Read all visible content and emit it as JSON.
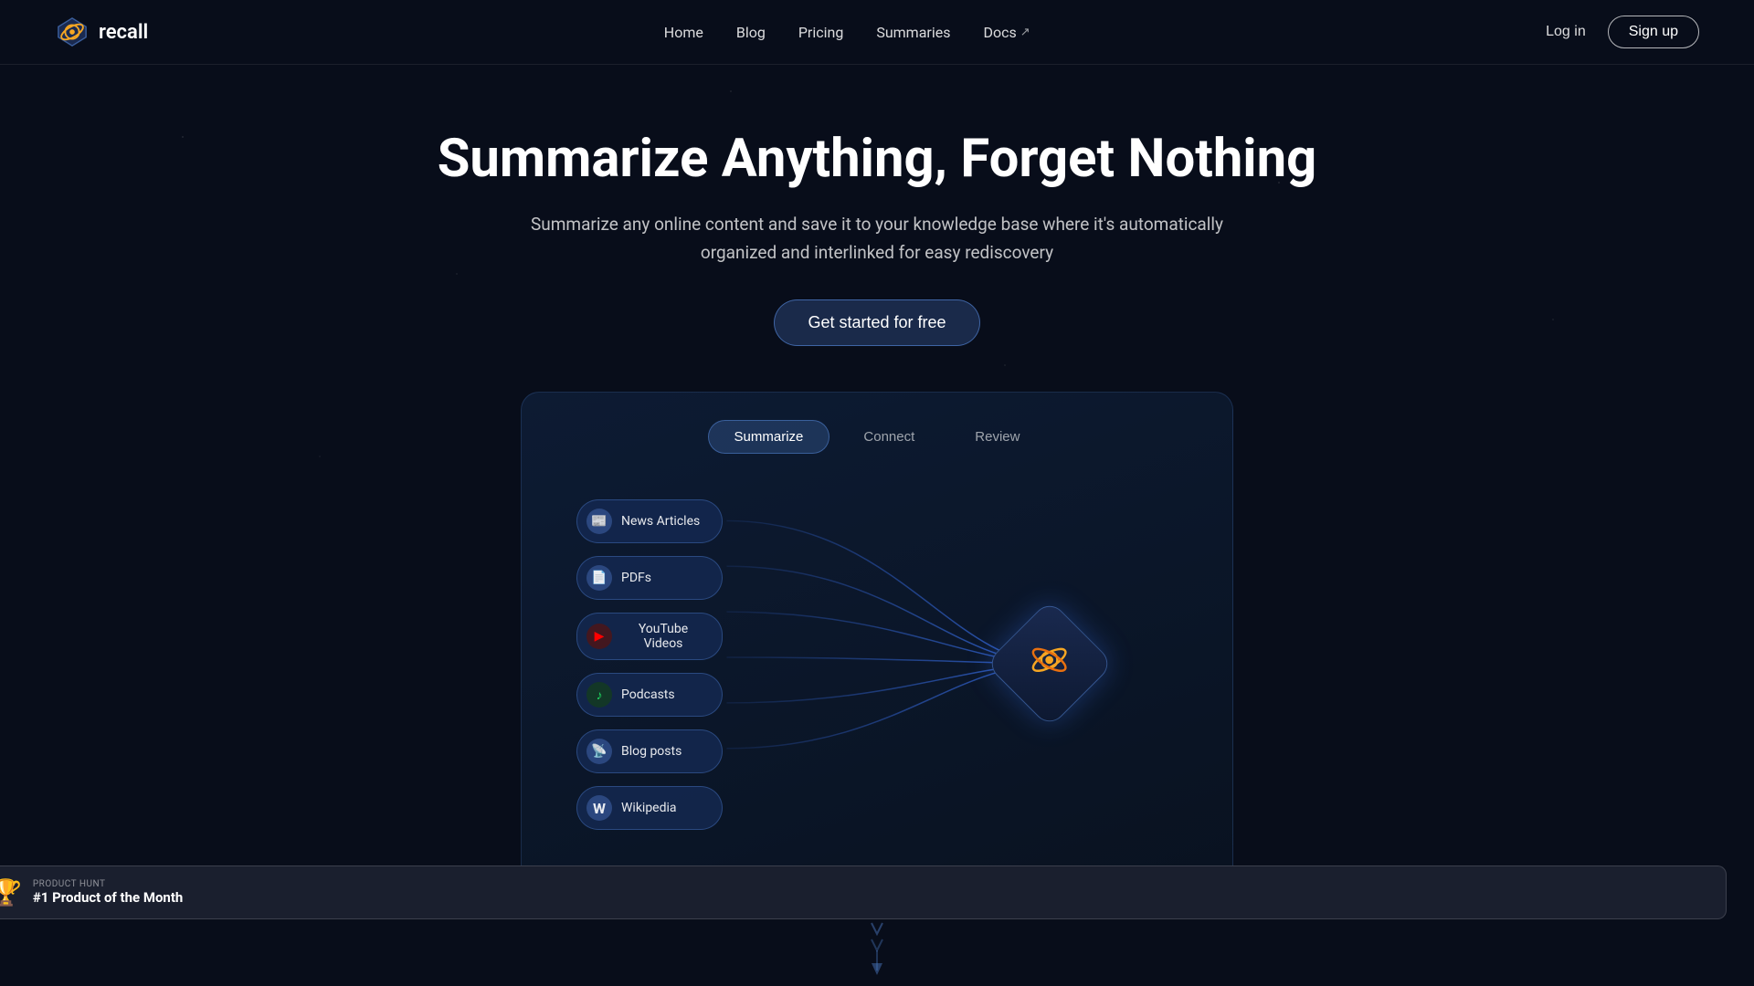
{
  "brand": {
    "name": "recall",
    "logo_alt": "Recall logo"
  },
  "nav": {
    "links": [
      {
        "label": "Home",
        "href": "#",
        "external": false
      },
      {
        "label": "Blog",
        "href": "#",
        "external": false
      },
      {
        "label": "Pricing",
        "href": "#",
        "external": false
      },
      {
        "label": "Summaries",
        "href": "#",
        "external": false
      },
      {
        "label": "Docs",
        "href": "#",
        "external": true
      }
    ],
    "login_label": "Log in",
    "signup_label": "Sign up"
  },
  "hero": {
    "headline": "Summarize Anything, Forget Nothing",
    "subheadline": "Summarize any online content and save it to your knowledge base where it's automatically organized and interlinked for easy rediscovery",
    "cta_label": "Get started for free"
  },
  "tabs": [
    {
      "label": "Summarize",
      "active": true
    },
    {
      "label": "Connect",
      "active": false
    },
    {
      "label": "Review",
      "active": false
    }
  ],
  "diagram": {
    "nodes": [
      {
        "label": "News Articles",
        "icon": "📰"
      },
      {
        "label": "PDFs",
        "icon": "📄"
      },
      {
        "label": "YouTube Videos",
        "icon": "▶"
      },
      {
        "label": "Podcasts",
        "icon": "🎵"
      },
      {
        "label": "Blog posts",
        "icon": "📡"
      },
      {
        "label": "Wikipedia",
        "icon": "W"
      }
    ],
    "center_icon": "⚛"
  },
  "product_hunt": {
    "label": "PRODUCT HUNT",
    "title": "#1 Product of the Month",
    "trophy_icon": "🏆"
  }
}
